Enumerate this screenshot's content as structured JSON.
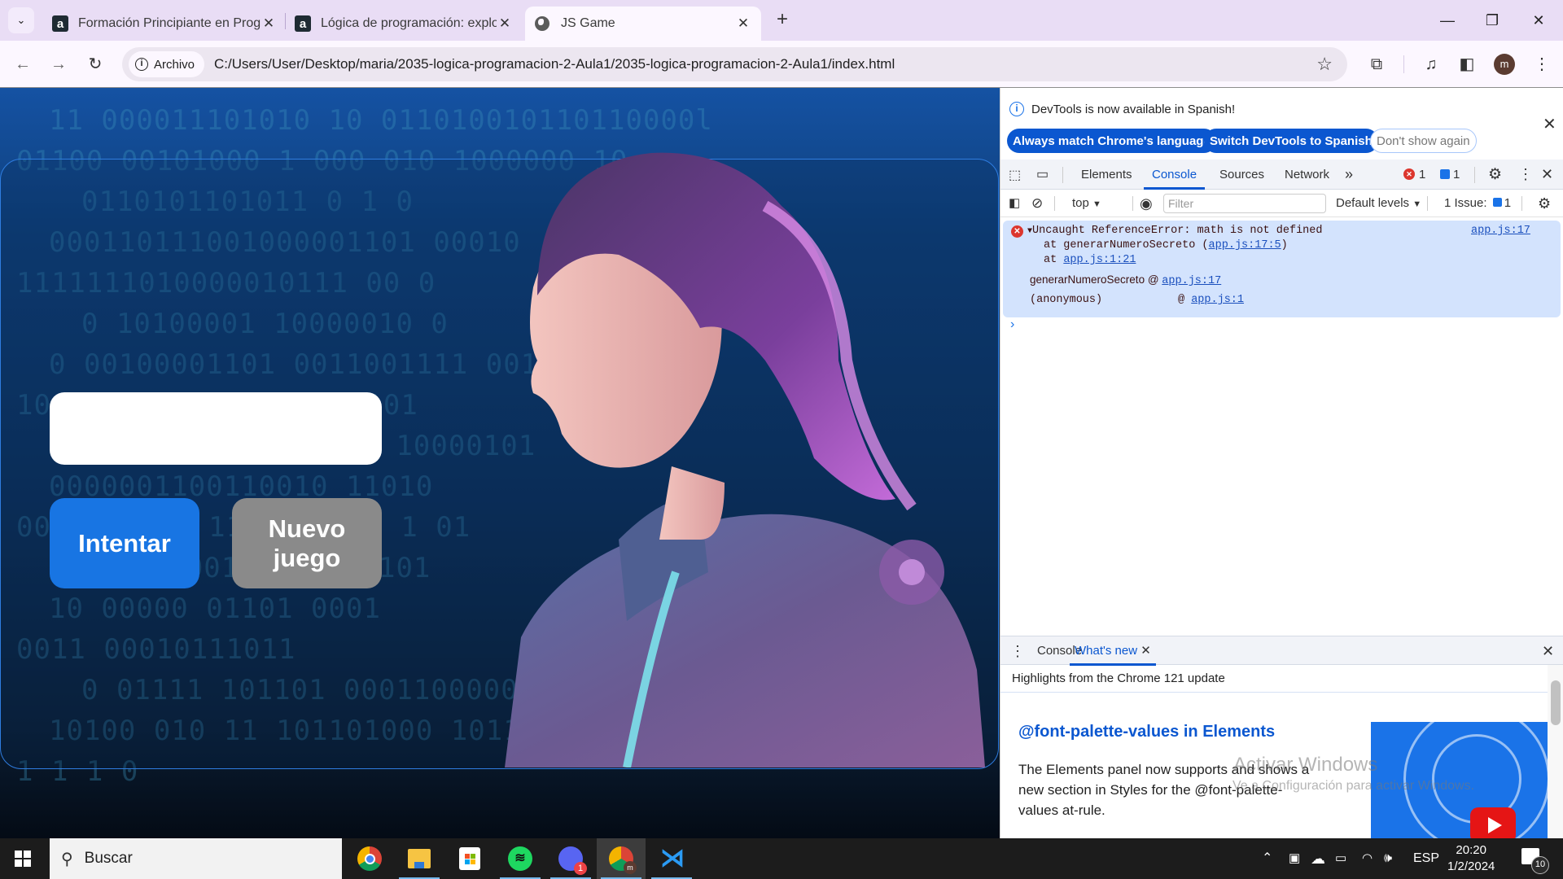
{
  "browser": {
    "tabs": [
      {
        "title": "Formación Principiante en Prog",
        "favicon": "alura-icon",
        "active": false
      },
      {
        "title": "Lógica de programación: explor",
        "favicon": "alura-icon",
        "active": false
      },
      {
        "title": "JS Game",
        "favicon": "globe-icon",
        "active": true
      }
    ],
    "tab_list_glyph": "⌄",
    "new_tab_glyph": "+",
    "close_glyph": "✕",
    "window_controls": {
      "minimize": "—",
      "restore": "❐",
      "close": "✕"
    },
    "nav": {
      "back": "←",
      "forward": "→",
      "reload": "↻"
    },
    "site_chip": "Archivo",
    "info_glyph": "i",
    "url": "C:/Users/User/Desktop/maria/2035-logica-programacion-2-Aula1/2035-logica-programacion-2-Aula1/index.html",
    "bookmark_glyph": "☆",
    "avatar_letter": "m",
    "toolbar_icons": {
      "extensions": "⧉",
      "media": "♫",
      "side_panel": "◧",
      "menu": "⋮"
    }
  },
  "game": {
    "input_value": "",
    "try_button": "Intentar",
    "new_game_button": "Nuevo juego",
    "binary_lines": [
      "11 000011101010 10 011010010110110000l",
      "01100 00101000 1   000 010         1000000 10",
      "0110101101011 0           1   0",
      "000110111001000001101                  00010",
      "1111111010000010111 00                 0",
      "0 10100001 10000010          0",
      "0 00100001101 0011001111     0011 00",
      "10001 00 10011100100101",
      "10 00000111000110 10000101",
      "0000001100110010 11010",
      "0000100001 1101000101 1 01",
      "1000110010111 11 101",
      "10        00000 01101 0001",
      "0011 00010111011",
      "0 01111  101101 0001100000",
      "10100 010 11 101101000 101100101 010 011000   0",
      "1   1        1   0"
    ]
  },
  "devtools": {
    "infobar": {
      "message": "DevTools is now available in Spanish!",
      "buttons": [
        "Always match Chrome's language",
        "Switch DevTools to Spanish",
        "Don't show again"
      ]
    },
    "tabs": [
      "Elements",
      "Console",
      "Sources",
      "Network"
    ],
    "active_tab": "Console",
    "more_tabs_glyph": "»",
    "error_count": "1",
    "message_count": "1",
    "console_toolbar": {
      "context": "top",
      "filter_placeholder": "Filter",
      "levels": "Default levels",
      "issues_label": "1 Issue:",
      "issues_count": "1"
    },
    "error": {
      "message": "Uncaught ReferenceError: math is not defined",
      "source_link": "app.js:17",
      "stack": [
        {
          "prefix": "at generarNumeroSecreto (",
          "link": "app.js:17:5",
          "suffix": ")"
        },
        {
          "prefix": "at ",
          "link": "app.js:1:21",
          "suffix": ""
        }
      ],
      "call_frames": [
        {
          "fn": "generarNumeroSecreto",
          "link": "app.js:17"
        },
        {
          "fn": "(anonymous)",
          "link": "app.js:1"
        }
      ]
    },
    "prompt_glyph": "›",
    "drawer": {
      "tabs": [
        "Console",
        "What's new"
      ],
      "active_tab": "What's new",
      "header": "Highlights from the Chrome 121 update",
      "article_title": "@font-palette-values in Elements",
      "article_body": "The Elements panel now supports and shows a new section in Styles for the @font-palette-values at-rule."
    },
    "watermark": {
      "title": "Activar Windows",
      "subtitle": "Ve a Configuración para activar Windows."
    }
  },
  "taskbar": {
    "search_placeholder": "Buscar",
    "apps": [
      {
        "name": "chrome",
        "open": false
      },
      {
        "name": "file-explorer",
        "open": true
      },
      {
        "name": "microsoft-store",
        "open": false
      },
      {
        "name": "spotify",
        "open": true
      },
      {
        "name": "discord",
        "open": true,
        "badge": "1"
      },
      {
        "name": "chrome-profile",
        "open": true,
        "active": true
      },
      {
        "name": "vscode",
        "open": true
      }
    ],
    "language": "ESP",
    "time": "20:20",
    "date": "1/2/2024",
    "notification_count": "10"
  },
  "colors": {
    "accent_blue": "#1875e3",
    "new_game_gray": "#8a8a8a",
    "devtools_blue": "#0b57d0",
    "error_red": "#dc362e",
    "error_bg": "#d3e3fd",
    "tabstrip": "#e9ddf5"
  }
}
